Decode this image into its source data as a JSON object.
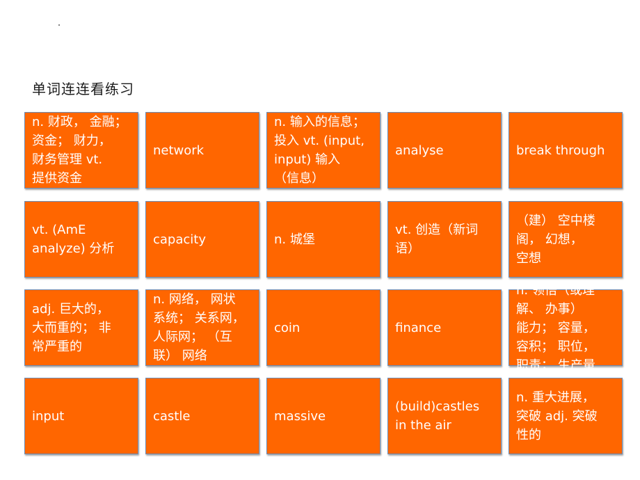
{
  "page": {
    "title": "单词连连看练习"
  },
  "tiles": [
    {
      "text": "n. 财政， 金融；\n资金； 财力，\n财务管理 vt.\n提供资金"
    },
    {
      "text": "network"
    },
    {
      "text": "n. 输入的信息；\n投入 vt. (input,\ninput) 输入\n（信息）"
    },
    {
      "text": "analyse"
    },
    {
      "text": "break through"
    },
    {
      "text": "vt. (AmE\nanalyze) 分析"
    },
    {
      "text": "capacity"
    },
    {
      "text": "n. 城堡"
    },
    {
      "text": "vt. 创造（新词\n语）"
    },
    {
      "text": "（建） 空中楼\n阁， 幻想，\n空想"
    },
    {
      "text": "adj. 巨大的，\n大而重的； 非\n常严重的"
    },
    {
      "text": "n. 网络， 网状\n系统； 关系网，\n人际网； （互\n联） 网络"
    },
    {
      "text": "coin"
    },
    {
      "text": "finance"
    },
    {
      "text": "n. 领悟（或理\n解、 办事）\n能力； 容量，\n容积； 职位，\n职责； 生产量"
    },
    {
      "text": "input"
    },
    {
      "text": "castle"
    },
    {
      "text": "massive"
    },
    {
      "text": "(build)castles\nin the air"
    },
    {
      "text": "n. 重大进展，\n突破 adj. 突破\n性的"
    }
  ],
  "colors": {
    "tile_fill": "#ff6600",
    "tile_text": "#ffffff",
    "tile_border": "#6b8bb5"
  }
}
